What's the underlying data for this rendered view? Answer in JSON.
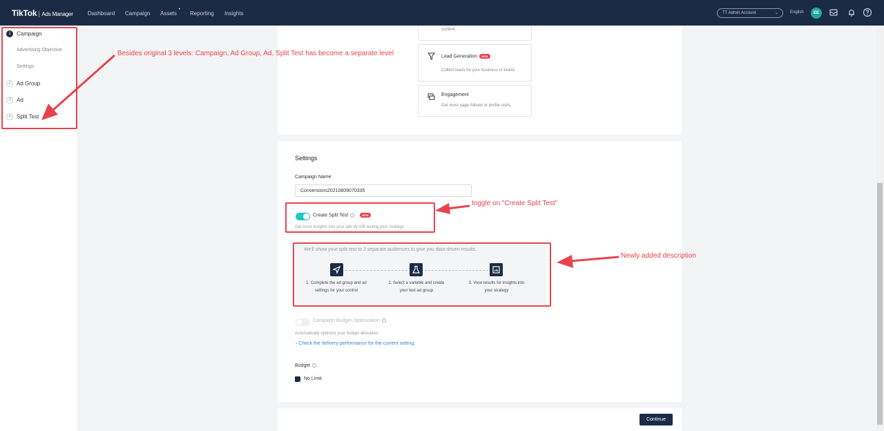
{
  "navbar": {
    "logo": "TikTok",
    "logo_sub": "Ads Manager",
    "items": [
      "Dashboard",
      "Campaign",
      "Assets",
      "Reporting",
      "Insights"
    ],
    "assets_dot": "•",
    "account": "TT Admin Account",
    "language": "English",
    "avatar_initials": "EE"
  },
  "sidebar": {
    "steps": [
      {
        "num": "1",
        "label": "Campaign"
      },
      {
        "num": "2",
        "label": "Ad Group"
      },
      {
        "num": "3",
        "label": "Ad"
      },
      {
        "num": "4",
        "label": "Split Test"
      }
    ],
    "substeps": [
      "Advertising Objective",
      "Settings"
    ]
  },
  "objectives": {
    "partial_desc": "content.",
    "lead_generation": {
      "title": "Lead Generation",
      "badge": "NEW",
      "desc": "Collect leads for your business or brand."
    },
    "engagement": {
      "title": "Engagement",
      "desc": "Get more page follows or profile visits."
    }
  },
  "settings": {
    "title": "Settings",
    "campaign_name_label": "Campaign Name",
    "campaign_name_value": "Conversions20210809070335",
    "split_test": {
      "label": "Create Split Test",
      "badge": "NEW",
      "help": "Get more insights into your ads by A/B testing your strategy.",
      "intro": "We'll show your split test to 2 separate audiences to give you data-driven results.",
      "steps": [
        {
          "line1": "1. Complete the ad group and ad",
          "line2": "settings for your control"
        },
        {
          "line1": "2. Select a variable and create",
          "line2": "your test ad group"
        },
        {
          "line1": "3. View results for insights into",
          "line2": "your strategy"
        }
      ]
    },
    "cbo": {
      "label": "Campaign Budget Optimization",
      "help": "Automatically optimize your budget allocation.",
      "link": "Check the delivery performance for the current setting."
    },
    "budget": {
      "label": "Budget",
      "no_limit": "No Limit"
    }
  },
  "actions": {
    "continue": "Continue"
  },
  "annotations": {
    "levels": "Besides original 3 levels: Campaign, Ad Group, Ad, Split Test has become a separate level",
    "toggle": "toggle on \"Create Split Test\"",
    "description": "Newly added description"
  },
  "colors": {
    "navy": "#1c2b45",
    "teal": "#20c9c0",
    "annotation_red": "#e8434c",
    "link_blue": "#3b7ee8"
  }
}
